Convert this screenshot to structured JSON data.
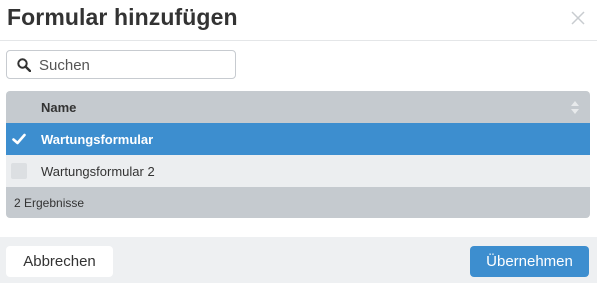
{
  "dialog": {
    "title": "Formular hinzufügen"
  },
  "search": {
    "placeholder": "Suchen",
    "value": ""
  },
  "grid": {
    "columns": [
      "Name"
    ],
    "rows": [
      {
        "name": "Wartungsformular",
        "selected": true
      },
      {
        "name": "Wartungsformular 2",
        "selected": false
      }
    ],
    "result_count": "2 Ergebnisse"
  },
  "actions": {
    "cancel_label": "Abbrechen",
    "apply_label": "Übernehmen"
  },
  "colors": {
    "accent": "#3d8ecf",
    "header_bg": "#c5cacf"
  }
}
